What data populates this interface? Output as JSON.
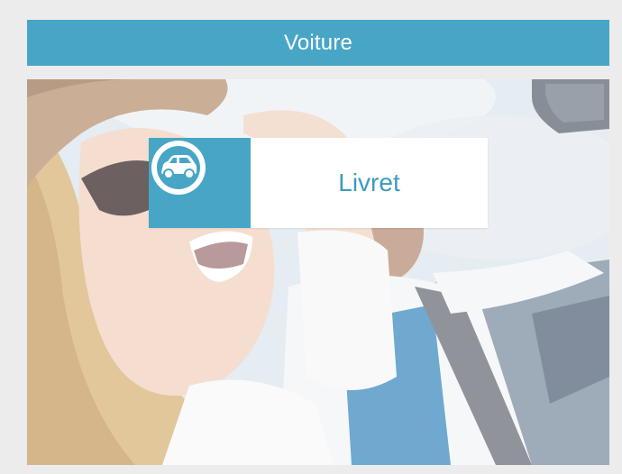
{
  "header": {
    "title": "Voiture"
  },
  "product": {
    "label": "Livret",
    "icon": "car-icon"
  },
  "colors": {
    "accent": "#47a6c6",
    "label_text": "#3d9bbd",
    "background": "#ececec"
  }
}
